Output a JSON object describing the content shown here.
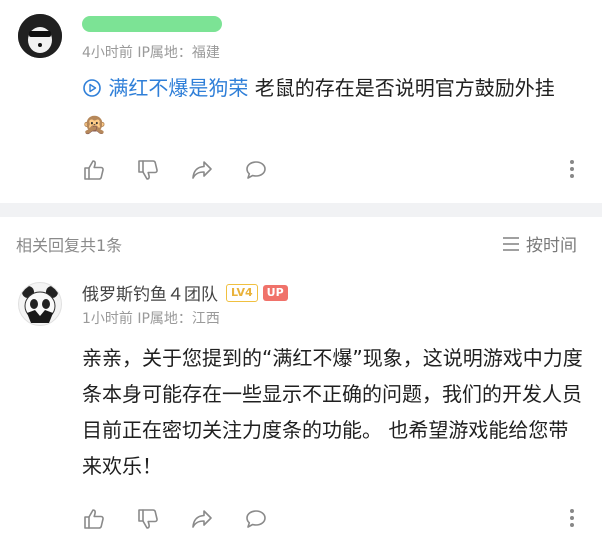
{
  "comment": {
    "meta": "4小时前  IP属地：福建",
    "link_text": "满红不爆是狗荣",
    "text": " 老鼠的存在是否说明官方鼓励外挂",
    "emoji": "🙊"
  },
  "replies_header": {
    "count_label": "相关回复共1条",
    "sort_label": "按时间"
  },
  "reply": {
    "username": "俄罗斯钓鱼４团队",
    "level_badge": "LV4",
    "up_badge": "UP",
    "meta": "1小时前  IP属地：江西",
    "text": "亲亲，关于您提到的“满红不爆”现象，这说明游戏中力度条本身可能存在一些显示不正确的问题，我们的开发人员目前正在密切关注力度条的功能。 也希望游戏能给您带来欢乐！"
  },
  "colors": {
    "link": "#2f7fd8",
    "level_badge": "#f0c040",
    "up_badge": "#f0726a",
    "redaction": "#6ee08a"
  }
}
